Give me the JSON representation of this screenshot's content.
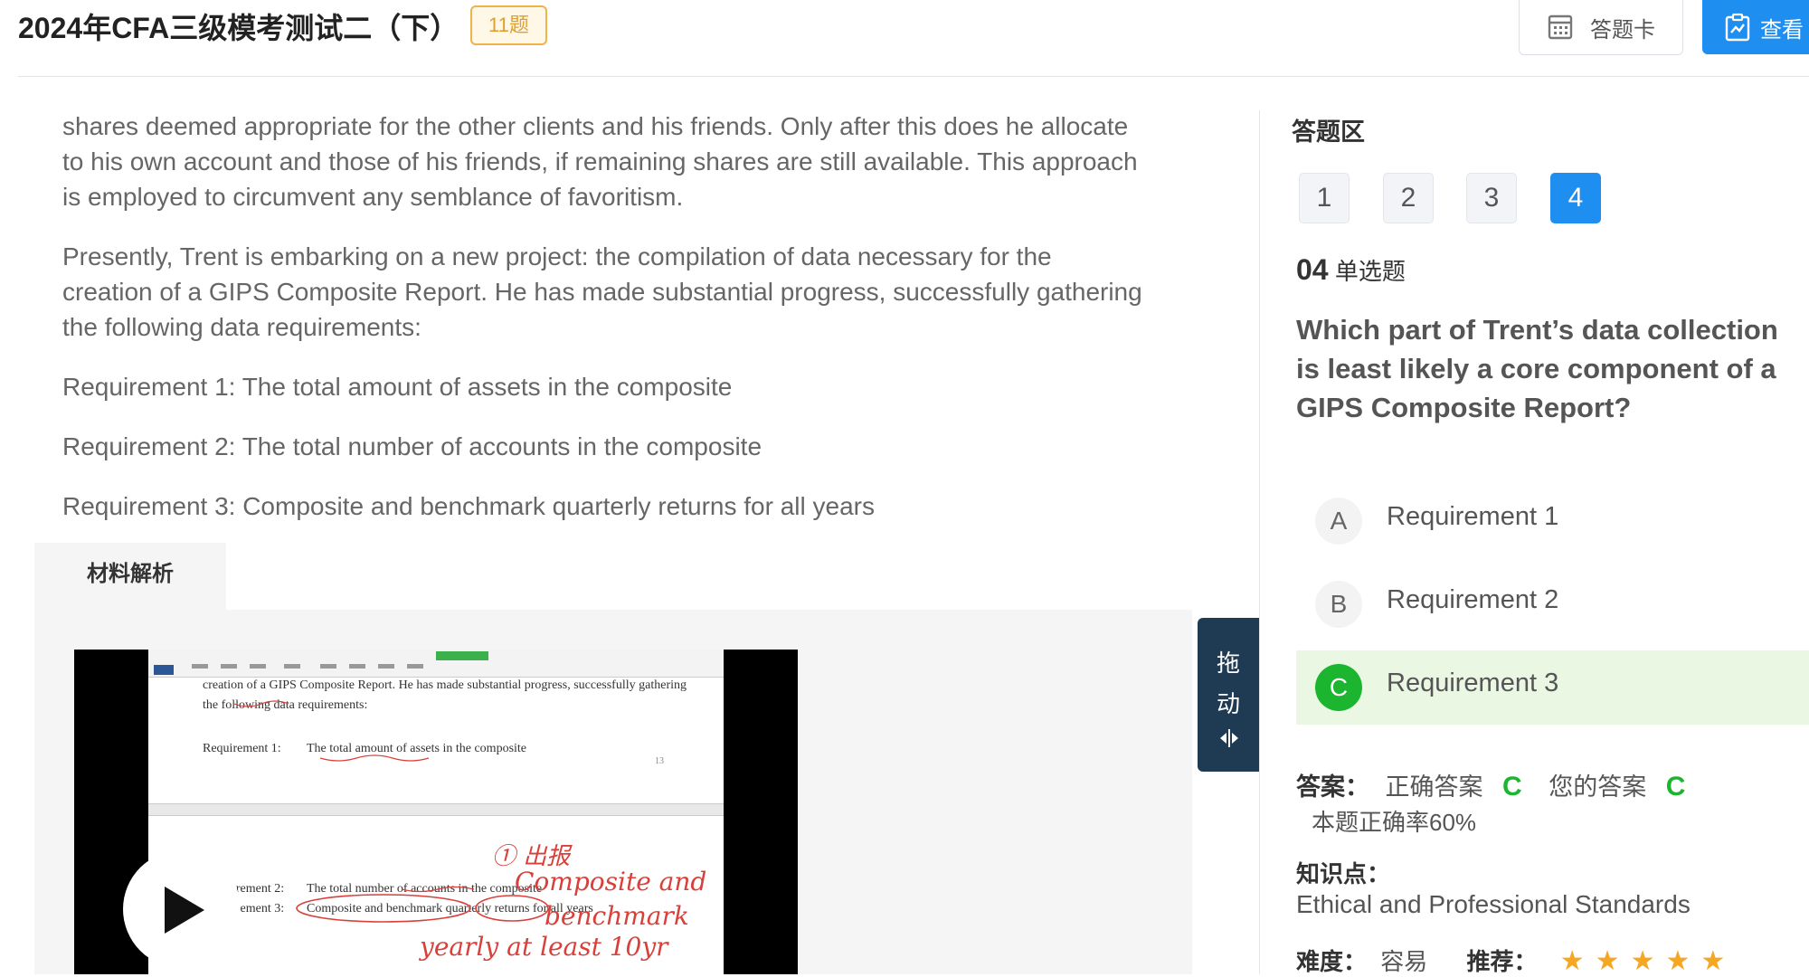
{
  "header": {
    "title": "2024年CFA三级模考测试二（下）",
    "count_badge": "11题",
    "answer_card_label": "答题卡",
    "view_label": "查看"
  },
  "article": {
    "paragraphs": [
      "shares deemed appropriate for the other clients and his friends. Only after this does he allocate to his own account and those of his friends, if remaining shares are still available. This approach is employed to circumvent any semblance of favoritism.",
      "Presently, Trent is embarking on a new project: the compilation of data necessary for the creation of a GIPS Composite Report. He has made substantial progress, successfully gathering the following data requirements:",
      "Requirement 1: The total amount of assets in the composite",
      "Requirement 2: The total number of accounts in the composite",
      "Requirement 3: Composite and benchmark quarterly returns for all years"
    ]
  },
  "analysis": {
    "tab_label": "材料解析",
    "video": {
      "doc_lines": [
        "creation of a GIPS Composite Report. He has made substantial progress, successfully gathering",
        "the following data requirements:",
        "Requirement 1:",
        "The total amount of assets in the composite",
        "13",
        "uirement 2:",
        "The total number of accounts in the composite",
        "uirement 3:",
        "Composite and benchmark quarterly returns for all years"
      ],
      "handwriting": [
        "① 出报",
        "Composite and",
        "benchmark",
        "yearly at least 10yr"
      ]
    }
  },
  "drag_handle": {
    "line1": "拖",
    "line2": "动",
    "icon": "resize-arrows-icon"
  },
  "answer_area": {
    "title": "答题区",
    "numbers": [
      "1",
      "2",
      "3",
      "4"
    ],
    "active_index": 3,
    "question_number": "04",
    "question_type": "单选题",
    "question": "Which part of Trent’s data collection is least likely a core component of a GIPS Composite Report?",
    "options": [
      {
        "letter": "A",
        "text": "Requirement 1"
      },
      {
        "letter": "B",
        "text": "Requirement 2"
      },
      {
        "letter": "C",
        "text": "Requirement 3"
      }
    ],
    "answer_label": "答案：",
    "correct_label": "正确答案",
    "correct_value": "C",
    "your_label": "您的答案",
    "your_value": "C",
    "accuracy": "本题正确率60%",
    "knowledge_label": "知识点：",
    "knowledge_value": "Ethical and Professional Standards",
    "difficulty_label": "难度：",
    "difficulty_value": "容易",
    "recommend_label": "推荐：",
    "recommend_stars": 5,
    "colors": {
      "accent": "#1e8ef0",
      "correct": "#1cb52f",
      "badge": "#f0b24a",
      "star": "#f5a623",
      "drag": "#1f3b53"
    }
  }
}
